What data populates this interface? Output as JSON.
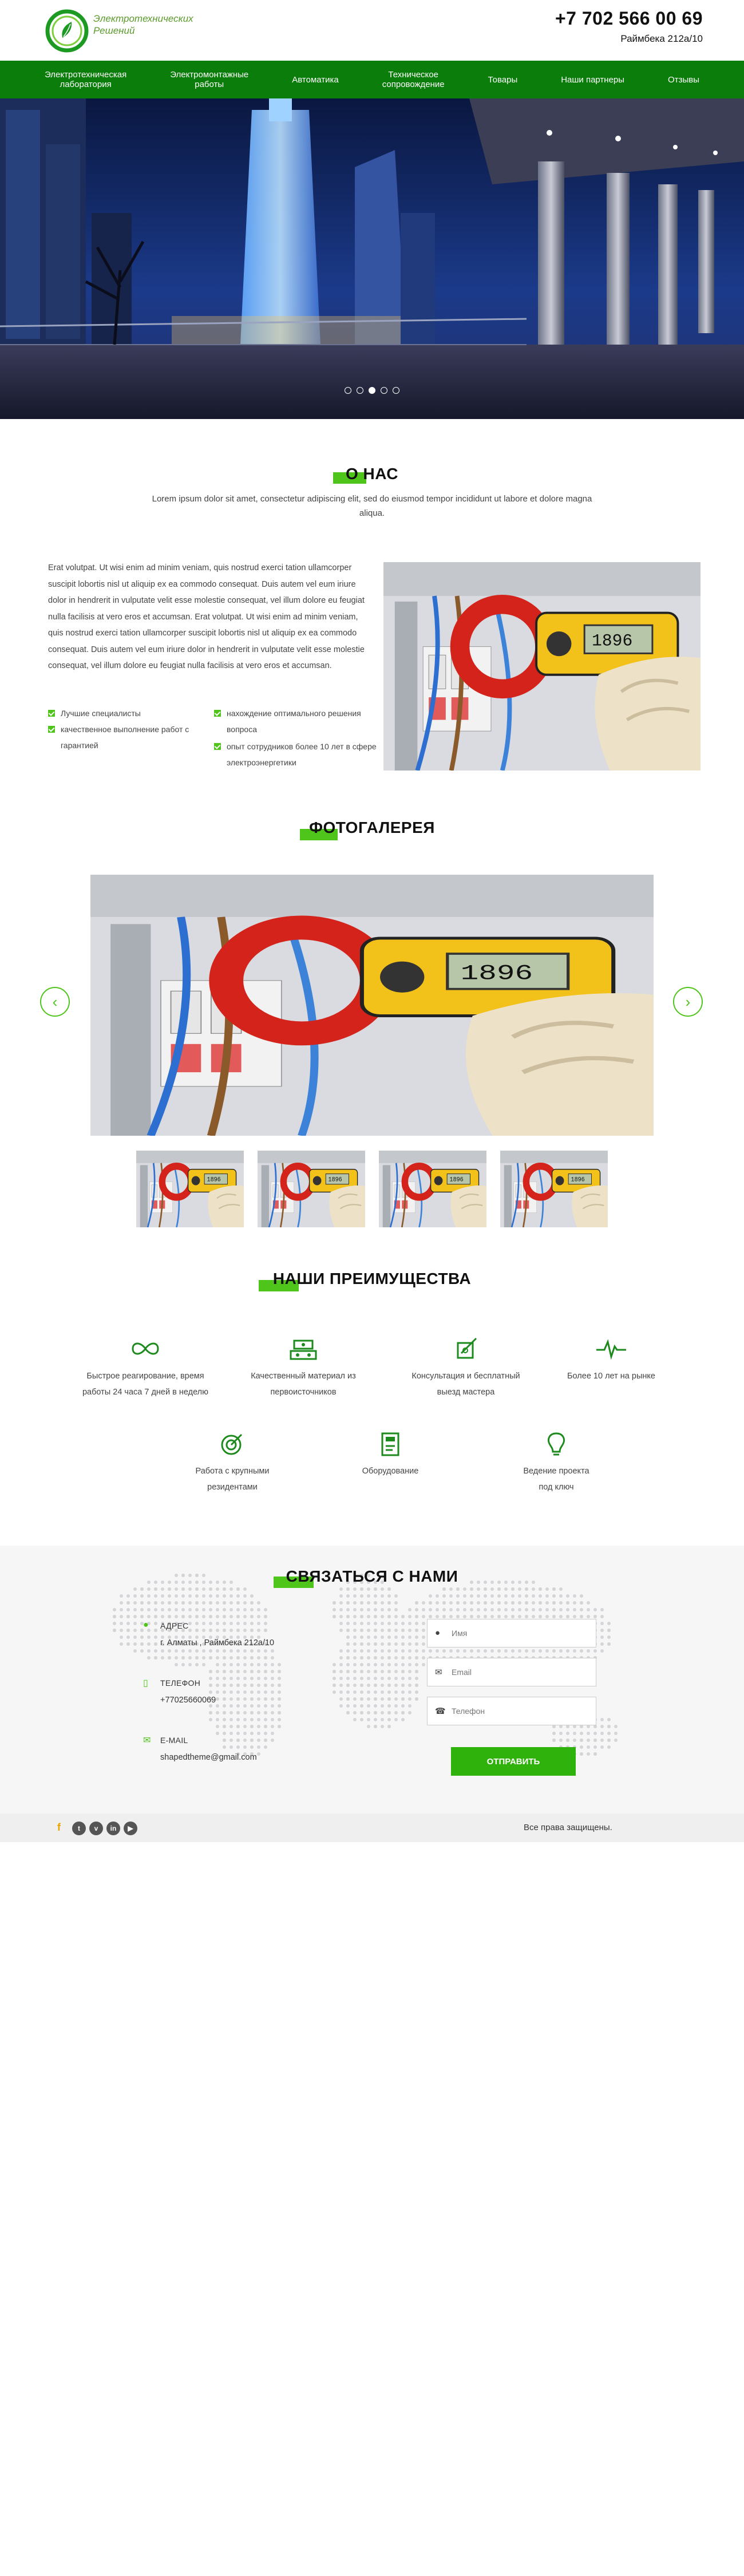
{
  "header": {
    "logo_text_line1": "Электротехнических",
    "logo_text_line2": "Решений",
    "phone": "+7 702 566 00 69",
    "address": "Раймбека 212а/10"
  },
  "nav": {
    "items": [
      {
        "line1": "Электротехническая",
        "line2": "лаборатория"
      },
      {
        "line1": "Электромонтажные",
        "line2": "работы"
      },
      {
        "line1": "Автоматика",
        "line2": ""
      },
      {
        "line1": "Техническое",
        "line2": "сопровождение"
      },
      {
        "line1": "Товары",
        "line2": ""
      },
      {
        "line1": "Наши партнеры",
        "line2": ""
      },
      {
        "line1": "Отзывы",
        "line2": ""
      }
    ]
  },
  "hero": {
    "slide_count": 5,
    "active_slide": 3
  },
  "about": {
    "title": "О НАС",
    "lead": "Lorem ipsum dolor sit amet, consectetur adipiscing elit, sed do eiusmod tempor incididunt ut labore et dolore magna aliqua.",
    "body": "Erat volutpat. Ut wisi enim ad minim veniam, quis nostrud exerci tation ullamcorper suscipit lobortis nisl ut aliquip ex ea commodo consequat. Duis autem vel eum iriure dolor in hendrerit in vulputate velit esse molestie consequat, vel illum dolore eu feugiat nulla facilisis at vero eros et accumsan. Erat volutpat. Ut wisi enim ad minim veniam, quis nostrud exerci tation ullamcorper suscipit lobortis nisl ut aliquip ex ea commodo consequat. Duis autem vel eum iriure dolor in hendrerit in vulputate velit esse molestie consequat, vel illum dolore eu feugiat nulla facilisis at vero eros et accumsan.",
    "features_left": [
      "Лучшие специалисты",
      "качественное выполнение работ с гарантией"
    ],
    "features_right": [
      "нахождение оптимального решения вопроса",
      "опыт сотрудников более 10 лет в сфере электроэнергетики"
    ]
  },
  "gallery": {
    "title": "ФОТОГАЛЕРЕЯ",
    "prev_icon": "chevron-left-icon",
    "next_icon": "chevron-right-icon",
    "thumb_count": 4
  },
  "advantages": {
    "title": "НАШИ ПРЕИМУЩЕСТВА",
    "items": [
      {
        "icon": "infinity-icon",
        "line1": "Быстрое реагирование, время",
        "line2": "работы 24 часа 7 дней в неделю"
      },
      {
        "icon": "materials-icon",
        "line1": "Качественный материал из",
        "line2": "первоисточников"
      },
      {
        "icon": "tools-icon",
        "line1": "Консультация и бесплатный",
        "line2": "выезд мастера"
      },
      {
        "icon": "pulse-icon",
        "line1": "Более 10 лет на рынке",
        "line2": ""
      },
      {
        "icon": "target-icon",
        "line1": "Работа с крупными",
        "line2": "резидентами"
      },
      {
        "icon": "equipment-icon",
        "line1": "Оборудование",
        "line2": ""
      },
      {
        "icon": "lightbulb-icon",
        "line1": "Ведение проекта",
        "line2": "под ключ"
      }
    ]
  },
  "contact": {
    "title": "СВЯЗАТЬСЯ С НАМИ",
    "address_label": "АДРЕС",
    "address_value": "г. Алматы , Раймбека 212а/10",
    "phone_label": "ТЕЛЕФОН",
    "phone_value": "+77025660069",
    "email_label": "E-MAIL",
    "email_value": "shapedtheme@gmail.com",
    "name_placeholder": "Имя",
    "email_placeholder": "Email",
    "phone_placeholder": "Телефон",
    "submit_label": "Отправить"
  },
  "footer": {
    "socials": [
      "f",
      "t",
      "v",
      "in",
      "▶"
    ],
    "copyright": "Все права защищены."
  },
  "colors": {
    "brand_green": "#0a7d0a",
    "accent_green": "#4fc41a",
    "button_green": "#2fb20c"
  }
}
